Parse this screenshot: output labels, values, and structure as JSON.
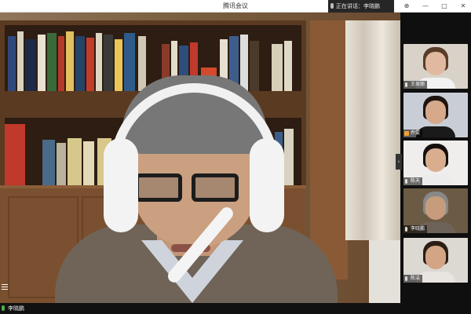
{
  "window": {
    "title": "腾讯会议",
    "speaking_label": "正在讲话：李晓鹏"
  },
  "window_buttons": [
    "⊕",
    "—",
    "□",
    "✕"
  ],
  "main": {
    "participant_name": "李晓鹏"
  },
  "participants": [
    {
      "name": "王美丽",
      "colors": {
        "bg": "#d9d2c8",
        "skin": "#e0b9a0",
        "hair": "#5a3b28",
        "body": "#f2f2f2"
      }
    },
    {
      "name": "乔雯",
      "colors": {
        "bg": "#c9cdd6",
        "skin": "#d6a98a",
        "hair": "#1e1410",
        "body": "#1a1a1a"
      }
    },
    {
      "name": "陈天",
      "colors": {
        "bg": "#f0eeec",
        "skin": "#d9ae8e",
        "hair": "#15100c",
        "body": "#ececec"
      }
    },
    {
      "name": "李晓鹏",
      "colors": {
        "bg": "#6b5a44",
        "skin": "#c79c7c",
        "hair": "#888888",
        "body": "#6e6358"
      }
    },
    {
      "name": "陈洁",
      "colors": {
        "bg": "#dcd8d2",
        "skin": "#d3a585",
        "hair": "#2a1d14",
        "body": "#e8e4df"
      }
    }
  ],
  "colors": {
    "titlebar": "#ffffff",
    "sidebar": "#0f0f0f",
    "active_mic": "#4caf50"
  }
}
